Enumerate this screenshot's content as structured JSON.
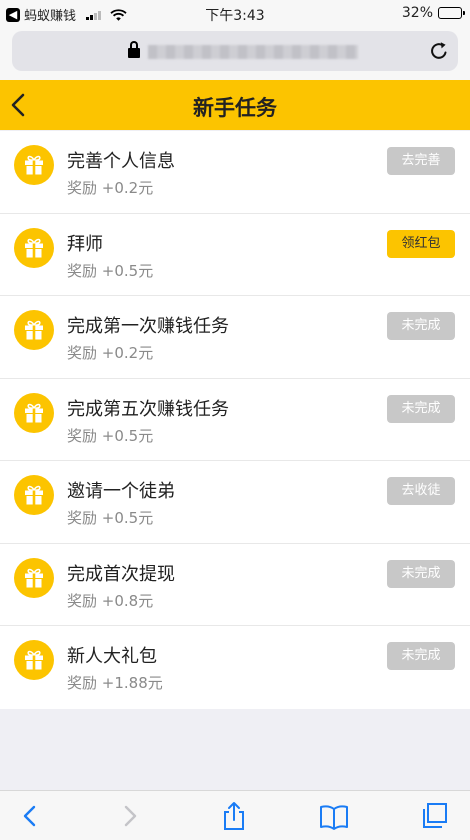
{
  "status_bar": {
    "back_app": "蚂蚁赚钱",
    "time": "下午3:43",
    "battery": "32%",
    "battery_level": 0.32
  },
  "header": {
    "title": "新手任务"
  },
  "tasks": [
    {
      "name": "完善个人信息",
      "reward": "奖励 +0.2元",
      "button": "去完善",
      "state": "disabled"
    },
    {
      "name": "拜师",
      "reward": "奖励 +0.5元",
      "button": "领红包",
      "state": "active"
    },
    {
      "name": "完成第一次赚钱任务",
      "reward": "奖励 +0.2元",
      "button": "未完成",
      "state": "disabled"
    },
    {
      "name": "完成第五次赚钱任务",
      "reward": "奖励 +0.5元",
      "button": "未完成",
      "state": "disabled"
    },
    {
      "name": "邀请一个徒弟",
      "reward": "奖励 +0.5元",
      "button": "去收徒",
      "state": "disabled"
    },
    {
      "name": "完成首次提现",
      "reward": "奖励 +0.8元",
      "button": "未完成",
      "state": "disabled"
    },
    {
      "name": "新人大礼包",
      "reward": "奖励 +1.88元",
      "button": "未完成",
      "state": "disabled"
    }
  ],
  "colors": {
    "accent": "#fcc400",
    "disabled_button": "#c8c8c8",
    "link_blue": "#1a7cf5"
  },
  "icons": {
    "header_back": "chevron-left-icon",
    "task": "gift-icon",
    "toolbar": [
      "back-icon",
      "forward-icon",
      "share-icon",
      "bookmarks-icon",
      "tabs-icon"
    ]
  }
}
